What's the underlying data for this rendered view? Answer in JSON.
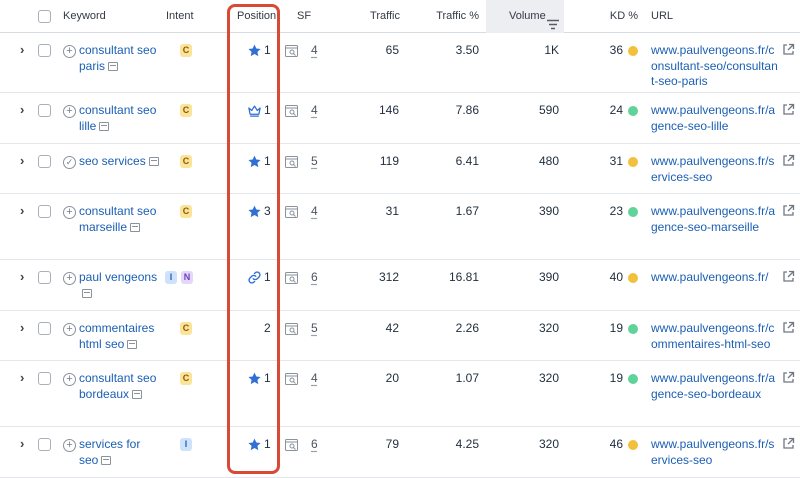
{
  "colors": {
    "link": "#1b5fb3",
    "highlight": "#d94a36",
    "kd_green": "#5fd39a",
    "kd_yellow": "#f2c03c",
    "star": "#2f6fd6"
  },
  "header": {
    "keyword": "Keyword",
    "intent": "Intent",
    "position": "Position",
    "sf": "SF",
    "traffic": "Traffic",
    "traffic_pct": "Traffic %",
    "volume": "Volume",
    "kd": "KD %",
    "url": "URL"
  },
  "rows": [
    {
      "keyword": "consultant seo paris",
      "kw_icon": "plus",
      "intents": [
        {
          "code": "C",
          "kind": "c"
        }
      ],
      "pos_icon": "star",
      "position": "1",
      "sf": "4",
      "traffic": "65",
      "traffic_pct": "3.50",
      "volume": "1K",
      "kd": "36",
      "kd_color": "yellow",
      "url": "www.paulvengeons.fr/consultant-seo/consultant-seo-paris"
    },
    {
      "keyword": "consultant seo lille",
      "kw_icon": "plus",
      "intents": [
        {
          "code": "C",
          "kind": "c"
        }
      ],
      "pos_icon": "crown",
      "position": "1",
      "sf": "4",
      "traffic": "146",
      "traffic_pct": "7.86",
      "volume": "590",
      "kd": "24",
      "kd_color": "green",
      "url": "www.paulvengeons.fr/agence-seo-lille"
    },
    {
      "keyword": "seo services",
      "kw_icon": "check",
      "intents": [
        {
          "code": "C",
          "kind": "c"
        }
      ],
      "pos_icon": "star",
      "position": "1",
      "sf": "5",
      "traffic": "119",
      "traffic_pct": "6.41",
      "volume": "480",
      "kd": "31",
      "kd_color": "yellow",
      "url": "www.paulvengeons.fr/services-seo"
    },
    {
      "keyword": "consultant seo marseille",
      "kw_icon": "plus",
      "intents": [
        {
          "code": "C",
          "kind": "c"
        }
      ],
      "pos_icon": "star",
      "position": "3",
      "sf": "4",
      "traffic": "31",
      "traffic_pct": "1.67",
      "volume": "390",
      "kd": "23",
      "kd_color": "green",
      "url": "www.paulvengeons.fr/agence-seo-marseille"
    },
    {
      "keyword": "paul vengeons",
      "kw_icon": "plus",
      "intents": [
        {
          "code": "I",
          "kind": "i"
        },
        {
          "code": "N",
          "kind": "n"
        }
      ],
      "pos_icon": "link",
      "position": "1",
      "sf": "6",
      "traffic": "312",
      "traffic_pct": "16.81",
      "volume": "390",
      "kd": "40",
      "kd_color": "yellow",
      "url": "www.paulvengeons.fr/"
    },
    {
      "keyword": "commentaires html seo",
      "kw_icon": "plus",
      "intents": [
        {
          "code": "C",
          "kind": "c"
        }
      ],
      "pos_icon": "",
      "position": "2",
      "sf": "5",
      "traffic": "42",
      "traffic_pct": "2.26",
      "volume": "320",
      "kd": "19",
      "kd_color": "green",
      "url": "www.paulvengeons.fr/commentaires-html-seo"
    },
    {
      "keyword": "consultant seo bordeaux",
      "kw_icon": "plus",
      "intents": [
        {
          "code": "C",
          "kind": "c"
        }
      ],
      "pos_icon": "star",
      "position": "1",
      "sf": "4",
      "traffic": "20",
      "traffic_pct": "1.07",
      "volume": "320",
      "kd": "19",
      "kd_color": "green",
      "url": "www.paulvengeons.fr/agence-seo-bordeaux"
    },
    {
      "keyword": "services for seo",
      "kw_icon": "plus",
      "intents": [
        {
          "code": "I",
          "kind": "i"
        }
      ],
      "pos_icon": "star",
      "position": "1",
      "sf": "6",
      "traffic": "79",
      "traffic_pct": "4.25",
      "volume": "320",
      "kd": "46",
      "kd_color": "yellow",
      "url": "www.paulvengeons.fr/services-seo"
    }
  ]
}
